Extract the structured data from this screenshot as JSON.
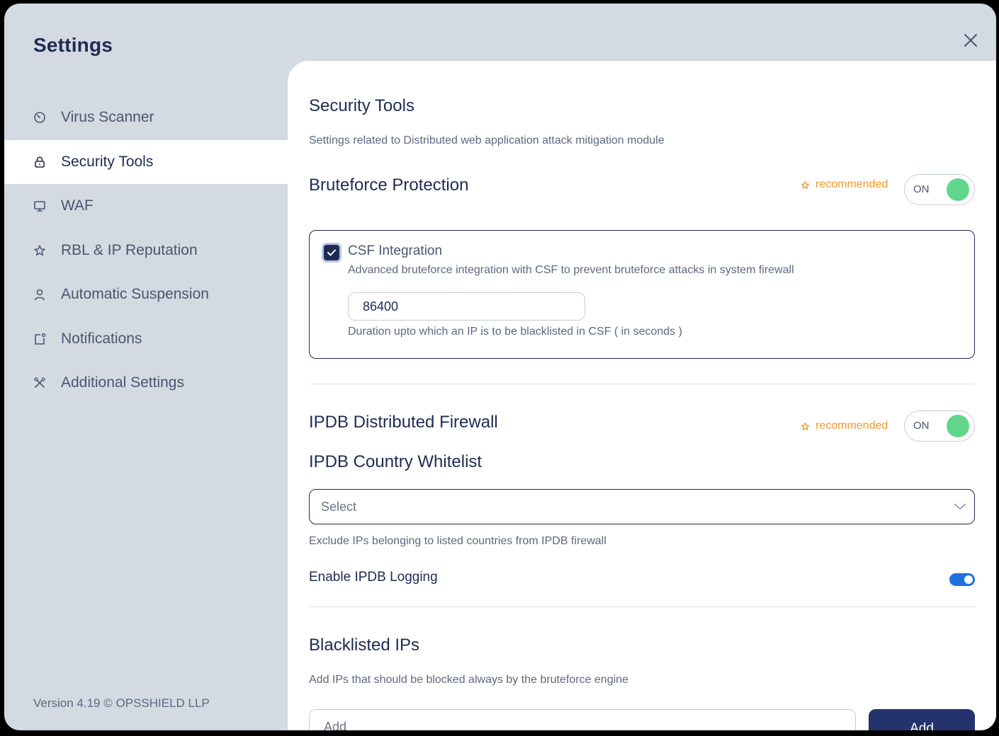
{
  "window": {
    "title": "Settings"
  },
  "sidebar": {
    "items": [
      {
        "label": "Virus Scanner",
        "icon": "clock-icon",
        "active": false
      },
      {
        "label": "Security Tools",
        "icon": "lock-icon",
        "active": true
      },
      {
        "label": "WAF",
        "icon": "monitor-icon",
        "active": false
      },
      {
        "label": "RBL & IP Reputation",
        "icon": "star-icon",
        "active": false
      },
      {
        "label": "Automatic Suspension",
        "icon": "user-icon",
        "active": false
      },
      {
        "label": "Notifications",
        "icon": "notification-icon",
        "active": false
      },
      {
        "label": "Additional Settings",
        "icon": "tools-icon",
        "active": false
      }
    ],
    "version": "Version 4.19 © OPSSHIELD LLP"
  },
  "main": {
    "title": "Security Tools",
    "description": "Settings related to Distributed web application attack mitigation module",
    "bruteforce": {
      "title": "Bruteforce Protection",
      "recommended": "recommended",
      "toggle_label": "ON",
      "csf": {
        "title": "CSF Integration",
        "checked": true,
        "description": "Advanced bruteforce integration with CSF to prevent bruteforce attacks in system firewall",
        "duration_value": "86400",
        "duration_hint": "Duration upto which an IP is to be blacklisted in CSF ( in seconds )"
      }
    },
    "ipdb": {
      "title": "IPDB Distributed Firewall",
      "recommended": "recommended",
      "toggle_label": "ON",
      "whitelist_title": "IPDB Country Whitelist",
      "select_value": "Select",
      "whitelist_hint": "Exclude IPs belonging to listed countries from IPDB firewall",
      "logging_label": "Enable IPDB Logging",
      "logging_enabled": true
    },
    "blacklist": {
      "title": "Blacklisted IPs",
      "description": "Add IPs that should be blocked always by the bruteforce engine",
      "input_placeholder": "Add",
      "add_button": "Add"
    }
  },
  "colors": {
    "accent": "#1e2b55",
    "toggle_on": "#5fd68a",
    "recommended": "#f0982e",
    "switch_on": "#1f6fe0"
  }
}
